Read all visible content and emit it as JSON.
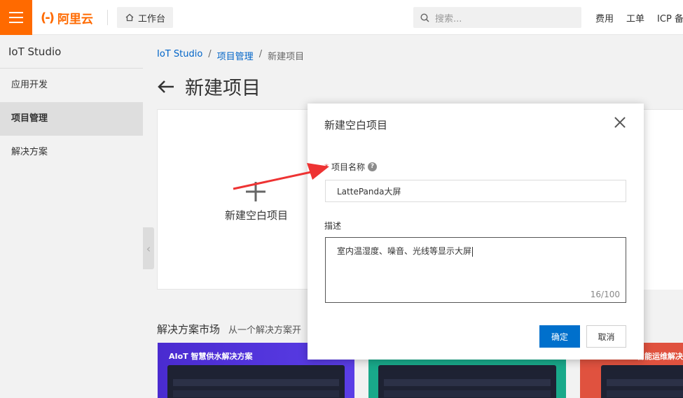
{
  "topbar": {
    "brand": "阿里云",
    "brand_mark": "(-)",
    "workbench": "工作台",
    "search_placeholder": "搜索...",
    "links": [
      "费用",
      "工单",
      "ICP 备"
    ]
  },
  "sidebar": {
    "brand": "IoT Studio",
    "items": [
      {
        "label": "应用开发",
        "active": false
      },
      {
        "label": "项目管理",
        "active": true
      },
      {
        "label": "解决方案",
        "active": false
      }
    ]
  },
  "breadcrumb": [
    "IoT Studio",
    "项目管理",
    "新建项目"
  ],
  "page": {
    "title": "新建项目",
    "new_blank_card": "新建空白项目",
    "market_title": "解决方案市场",
    "market_subtitle": "从一个解决方案开",
    "solutions": [
      {
        "title": "AIoT 智慧供水解决方案"
      },
      {
        "title": ""
      },
      {
        "title": "智能运维解决"
      }
    ]
  },
  "modal": {
    "title": "新建空白项目",
    "name_label": "项目名称",
    "name_value": "LattePanda大屏",
    "desc_label": "描述",
    "desc_value": "室内温湿度、噪音、光线等显示大屏",
    "char_count": "16/100",
    "ok": "确定",
    "cancel": "取消"
  },
  "colors": {
    "brand": "#ff6a00",
    "primary": "#0070cc",
    "link": "#0064c8",
    "annotation": "#ee3333"
  }
}
